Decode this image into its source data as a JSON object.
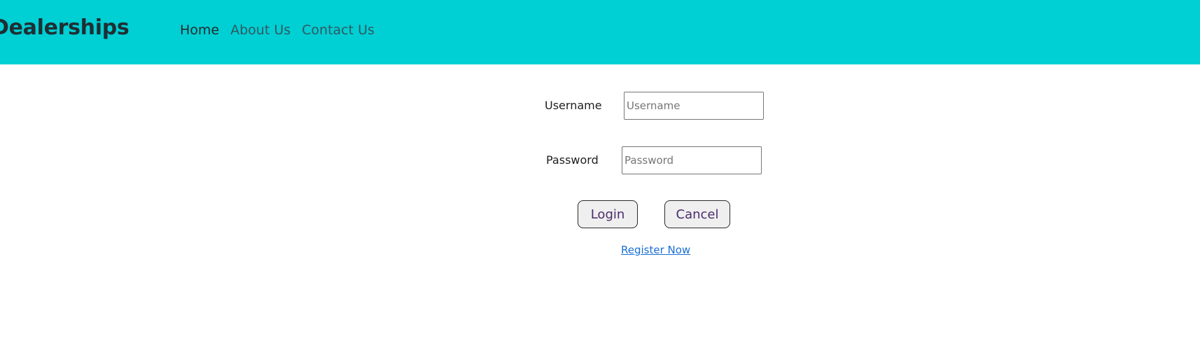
{
  "nav": {
    "brand": "Dealerships",
    "links": [
      {
        "label": "Home",
        "active": true
      },
      {
        "label": "About Us",
        "active": false
      },
      {
        "label": "Contact Us",
        "active": false
      }
    ]
  },
  "login_form": {
    "username_label": "Username",
    "username_placeholder": "Username",
    "username_value": "",
    "password_label": "Password",
    "password_placeholder": "Password",
    "password_value": "",
    "login_button": "Login",
    "cancel_button": "Cancel",
    "register_link": "Register Now"
  },
  "colors": {
    "navbar_bg": "#00cfd4",
    "link_color": "#1a6fd6",
    "button_text": "#4a2c6a"
  }
}
